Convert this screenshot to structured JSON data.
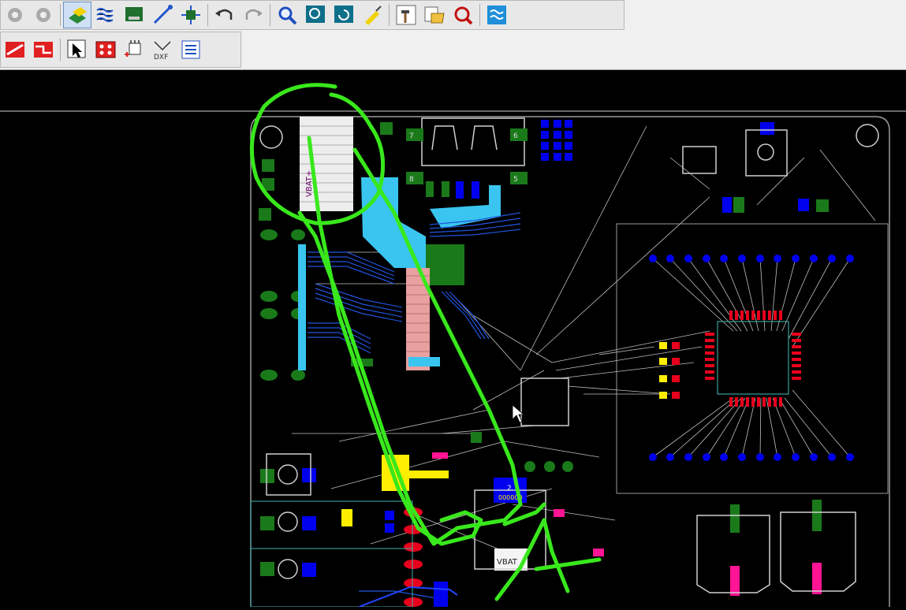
{
  "toolbar": {
    "row1": [
      {
        "name": "settings-gear-icon"
      },
      {
        "name": "settings-gear-2-icon"
      },
      {
        "name": "layer-display-icon",
        "pressed": true
      },
      {
        "name": "copper-pour-icon"
      },
      {
        "name": "board-outline-icon"
      },
      {
        "name": "route-trace-icon"
      },
      {
        "name": "component-icon"
      },
      {
        "name": "undo-icon"
      },
      {
        "name": "redo-icon"
      },
      {
        "name": "zoom-icon"
      },
      {
        "name": "zoom-window-icon"
      },
      {
        "name": "refresh-icon"
      },
      {
        "name": "highlight-icon"
      },
      {
        "name": "build-hammer-icon"
      },
      {
        "name": "open-folder-icon"
      },
      {
        "name": "design-check-icon"
      },
      {
        "name": "layers-stack-icon"
      }
    ],
    "row2": [
      {
        "name": "trace-layer-red-icon"
      },
      {
        "name": "trace-layer-red-2-icon"
      },
      {
        "name": "select-pointer-icon"
      },
      {
        "name": "pad-array-icon"
      },
      {
        "name": "place-component-icon"
      },
      {
        "name": "dxf-export-icon"
      },
      {
        "name": "list-report-icon"
      }
    ]
  },
  "board": {
    "labels": {
      "vbat_top": "VBAT+",
      "vbat_bottom": "VBAT",
      "conn_7": "7",
      "conn_6": "6",
      "conn_8": "8",
      "conn_5": "5",
      "chip_2": "2",
      "chip_num": "000000"
    },
    "colors": {
      "board_bg": "#000000",
      "outline": "#9a9a9a",
      "pad_blue": "#0000ff",
      "pad_green": "#1a8a1a",
      "trace_cyan": "#39c5f0",
      "trace_pink": "#e8a0a0",
      "annotation": "#39e81c",
      "pad_yellow": "#ffee00",
      "pad_red": "#e8001c",
      "pad_magenta": "#ff1493"
    }
  }
}
